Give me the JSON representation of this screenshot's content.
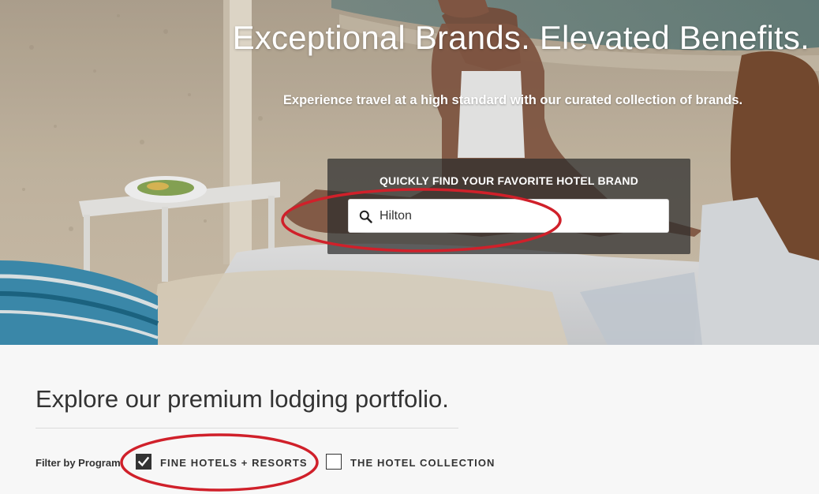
{
  "hero": {
    "title": "Exceptional Brands. Elevated Benefits.",
    "subtitle": "Experience travel at a high standard with our curated collection of brands."
  },
  "search": {
    "heading": "QUICKLY FIND YOUR FAVORITE HOTEL BRAND",
    "value": "Hilton",
    "icon": "search-icon"
  },
  "portfolio": {
    "heading": "Explore our premium lodging portfolio."
  },
  "filters": {
    "label": "Filter by Program",
    "options": [
      {
        "label": "FINE HOTELS + RESORTS",
        "checked": true
      },
      {
        "label": "THE HOTEL COLLECTION",
        "checked": false
      }
    ]
  },
  "annotations": {
    "color": "#d0202a"
  },
  "colors": {
    "text": "#333333",
    "panel": "#2d2d2d",
    "background": "#f7f7f7"
  }
}
